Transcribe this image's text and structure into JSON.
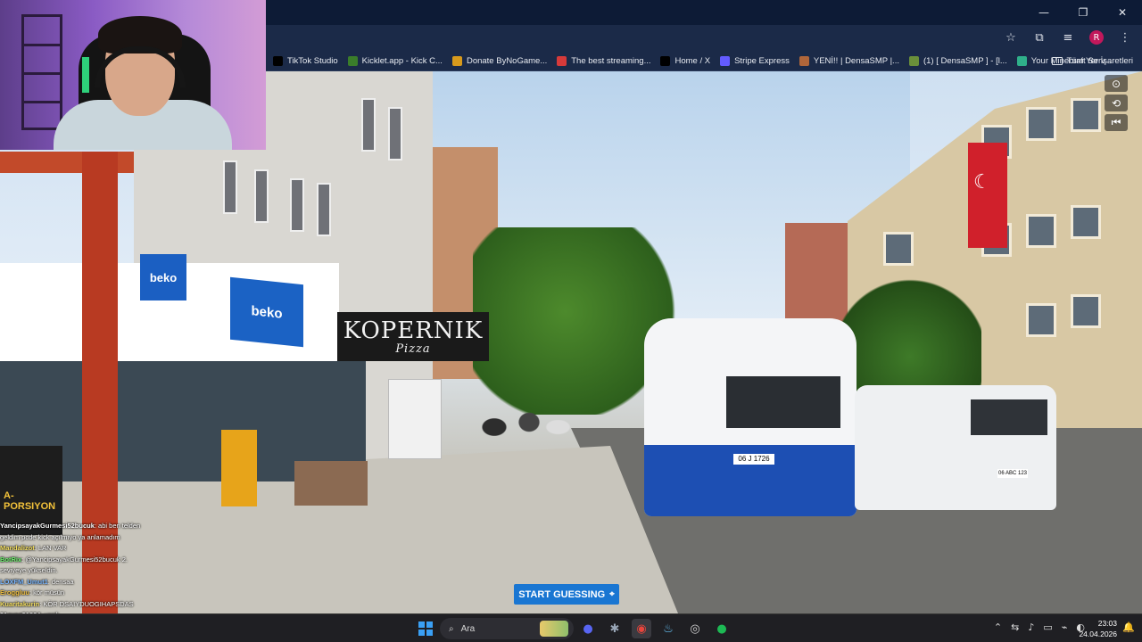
{
  "browser": {
    "window_controls": {
      "minimize": "—",
      "maximize": "❐",
      "close": "✕"
    },
    "address_icons": [
      "star-icon",
      "extensions-icon",
      "media-icon"
    ],
    "profile_initial": "R",
    "bookmarks": [
      {
        "label": "TikTok Studio",
        "icon": "tiktok-icon",
        "color": "#000000"
      },
      {
        "label": "Kicklet.app - Kick C...",
        "icon": "kicklet-icon",
        "color": "#3a7d2a"
      },
      {
        "label": "Donate ByNoGame...",
        "icon": "bynogame-icon",
        "color": "#d79a1c"
      },
      {
        "label": "The best streaming...",
        "icon": "streaming-icon",
        "color": "#d63a3a"
      },
      {
        "label": "Home / X",
        "icon": "x-icon",
        "color": "#000000"
      },
      {
        "label": "Stripe Express",
        "icon": "stripe-icon",
        "color": "#635bff"
      },
      {
        "label": "YENİ!! | DensaSMP |...",
        "icon": "densa-icon",
        "color": "#b0663a"
      },
      {
        "label": "(1) [ DensaSMP ] - [l...",
        "icon": "densa2-icon",
        "color": "#6a8f3a"
      },
      {
        "label": "Your Minecraft Serv...",
        "icon": "minecraft-icon",
        "color": "#2fb08a"
      }
    ],
    "all_bookmarks_label": "Tüm Yer İşaretleri"
  },
  "scene": {
    "signs": {
      "beko_small": "beko",
      "beko_large": "beko",
      "kopernik_title": "KOPERNIK",
      "kopernik_sub": "Pizza",
      "left_sign": "A-PORSIYON",
      "van_plate": "06 J 1726",
      "car_plate": "06 ABC 123"
    }
  },
  "streetview": {
    "controls": [
      "compass-icon",
      "refresh-icon",
      "back-to-start-icon"
    ],
    "start_guessing_label": "START GUESSING"
  },
  "chat": [
    {
      "user": "YancipsayakGurmesi52bucuk",
      "text": ": abi ben telden",
      "color": "#ffffff"
    },
    {
      "user": "",
      "text": "geldim pcde kick açılmıyo ya anlamadım",
      "color": "#ffffff"
    },
    {
      "user": "Mandalizot",
      "text": ": LAN VAR",
      "color": "#f5e063"
    },
    {
      "user": "BotRix",
      "text": ": @YancipsayakGurmesi52bucuk 2.",
      "color": "#6cf06c"
    },
    {
      "user": "",
      "text": "seviyeye yükseldin.",
      "color": "#ffffff"
    },
    {
      "user": "LOXFM_Umut1",
      "text": ": densaa",
      "color": "#7ab7ff"
    },
    {
      "user": "Eroggluu",
      "text": ": kör müsün",
      "color": "#f0c040"
    },
    {
      "user": "Kuaritakurin",
      "text": ": KÖR DSAIYDUOGIHAPSDAS",
      "color": "#f5e063"
    },
    {
      "user": "31ayaz31224",
      "text": ": vardı",
      "color": "#ffffff"
    },
    {
      "user": "LOXFM_Umut1",
      "text": ": var",
      "color": "#7ab7ff"
    }
  ],
  "taskbar": {
    "search_placeholder": "Ara",
    "apps": [
      {
        "name": "discord-icon",
        "glyph": "●",
        "color": "#5865f2"
      },
      {
        "name": "settings-app-icon",
        "glyph": "✱",
        "color": "#9aa7b8"
      },
      {
        "name": "chrome-icon",
        "glyph": "◉",
        "color": "#e8453c"
      },
      {
        "name": "steam-icon",
        "glyph": "♨",
        "color": "#66c0f4"
      },
      {
        "name": "obs-icon",
        "glyph": "◎",
        "color": "#d0d0d0"
      },
      {
        "name": "spotify-icon",
        "glyph": "●",
        "color": "#1db954"
      }
    ],
    "tray": [
      "⌃",
      "⇆",
      "♪",
      "▭",
      "⌁",
      "◐"
    ],
    "time": "23:03",
    "date": "24.04.2026"
  }
}
